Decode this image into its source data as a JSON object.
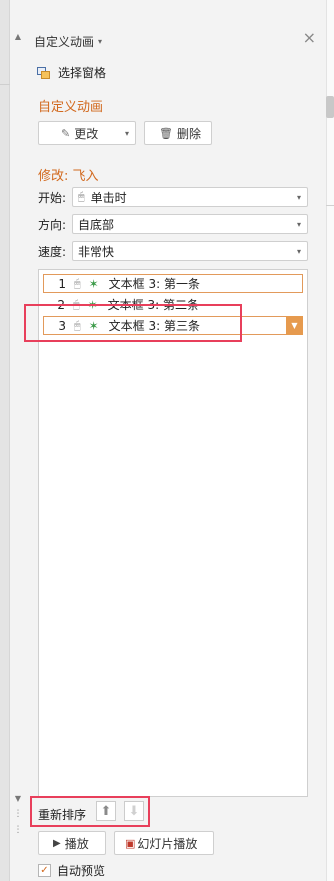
{
  "pane": {
    "title": "自定义动画",
    "title_caret": "▾",
    "close_icon": "×"
  },
  "selection_pane": {
    "label": "选择窗格"
  },
  "custom_animation": {
    "heading": "自定义动画",
    "change_button": "更改",
    "delete_button": "删除"
  },
  "modify": {
    "heading": "修改: 飞入",
    "start": {
      "label": "开始:",
      "value": "单击时"
    },
    "direction": {
      "label": "方向:",
      "value": "自底部"
    },
    "speed": {
      "label": "速度:",
      "value": "非常快"
    }
  },
  "animations": [
    {
      "number": "1",
      "text": "文本框 3: 第一条"
    },
    {
      "number": "2",
      "text": "文本框 3: 第二条"
    },
    {
      "number": "3",
      "text": "文本框 3: 第三条"
    }
  ],
  "reorder": {
    "label": "重新排序"
  },
  "play_button": "播放",
  "slideshow_button": "幻灯片播放",
  "auto_preview": {
    "label": "自动预览",
    "checked": true
  },
  "colors": {
    "accent": "#d2691e",
    "highlight": "#e83f5b",
    "selected_border": "#e29a5b"
  }
}
